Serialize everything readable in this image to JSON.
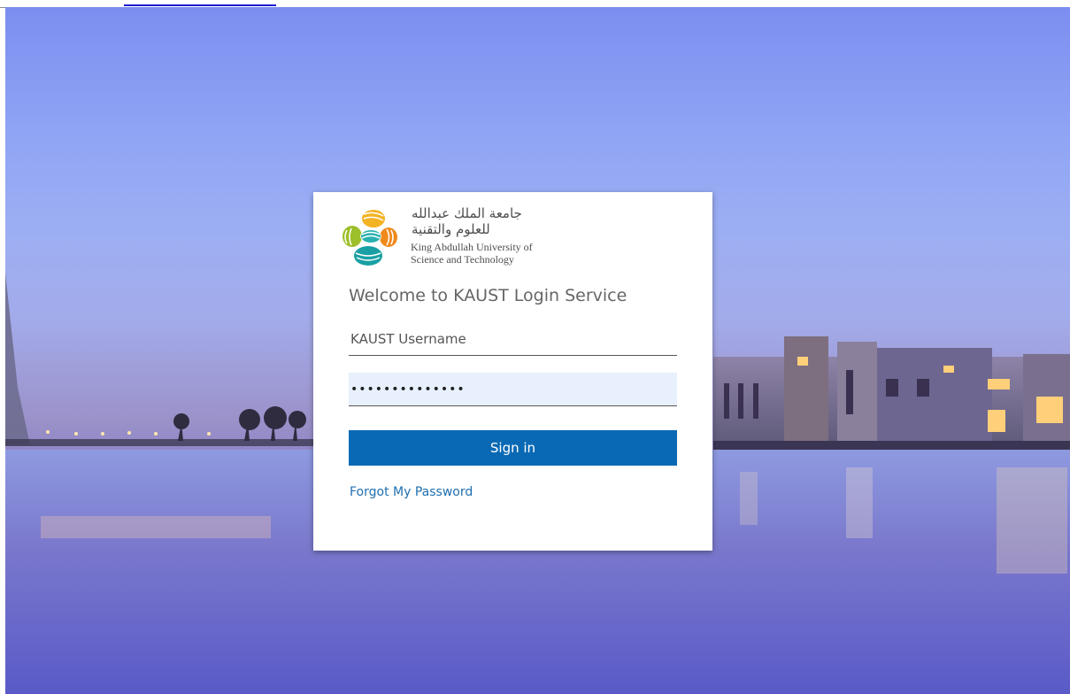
{
  "university": {
    "name_arabic_line1": "جامعة الملك عبدالله",
    "name_arabic_line2": "للعلوم والتقنية",
    "name_english_line1": "King Abdullah University of",
    "name_english_line2": "Science and Technology",
    "logo_colors": [
      "#f3b323",
      "#9cbf2b",
      "#f08a1d",
      "#1aa0a4",
      "#2ab0b0"
    ]
  },
  "login": {
    "title": "Welcome to KAUST Login Service",
    "username_placeholder": "KAUST Username",
    "username_value": "",
    "password_value": "••••••••••••••",
    "sign_in_label": "Sign in",
    "forgot_password_label": "Forgot My Password"
  },
  "colors": {
    "accent": "#0a69b4",
    "link": "#1f6fb0"
  }
}
